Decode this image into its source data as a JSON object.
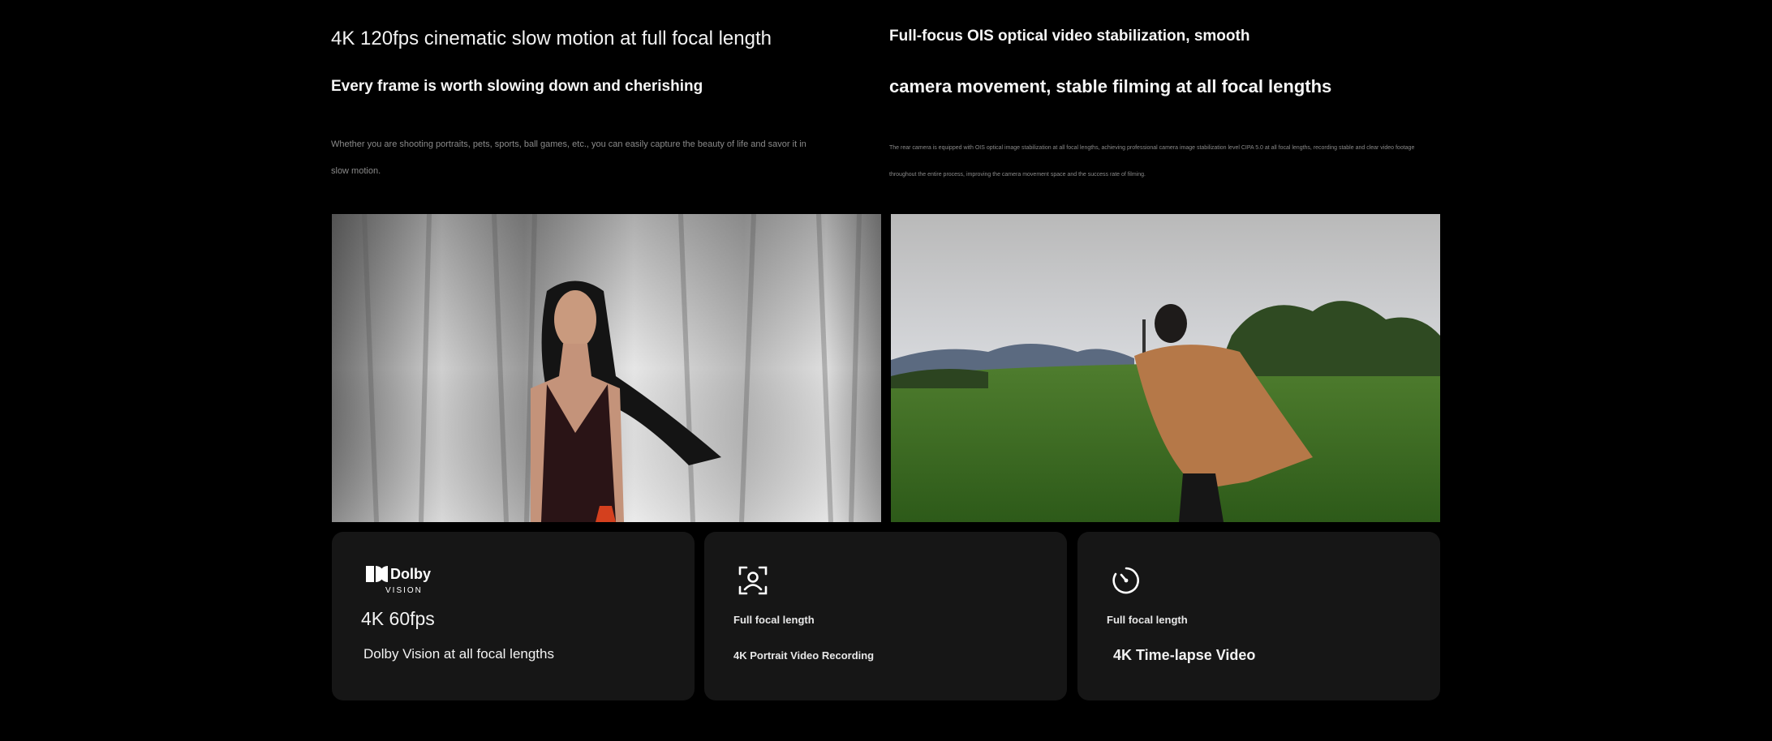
{
  "left_block": {
    "title": "4K 120fps cinematic slow motion at full focal length",
    "subtitle": "Every frame is worth slowing down and cherishing",
    "description": "Whether you are shooting portraits, pets, sports, ball games, etc., you can easily capture the beauty of life and savor it in slow motion."
  },
  "right_block": {
    "title": "Full-focus OIS optical video stabilization, smooth",
    "subtitle": "camera movement, stable filming at all focal lengths",
    "description": "The rear camera is equipped with OIS optical image stabilization at all focal lengths, achieving professional camera image stabilization level CIPA 5.0 at all focal lengths, recording stable and clear video footage throughout the entire process, improving the camera movement space and the success rate of filming."
  },
  "cards": [
    {
      "logo_text": "Dolby",
      "logo_subtext": "VISION",
      "big_text": "4K 60fps",
      "caption": "Dolby Vision at all focal lengths"
    },
    {
      "icon": "portrait-focus-icon",
      "label": "Full focal length",
      "caption": "4K Portrait Video Recording"
    },
    {
      "icon": "timer-icon",
      "label": "Full focal length",
      "caption": "4K Time-lapse Video"
    }
  ],
  "colors": {
    "background": "#000000",
    "card_background": "#161616",
    "text_primary": "#f5f5f5",
    "text_muted": "#8a8a8a"
  }
}
